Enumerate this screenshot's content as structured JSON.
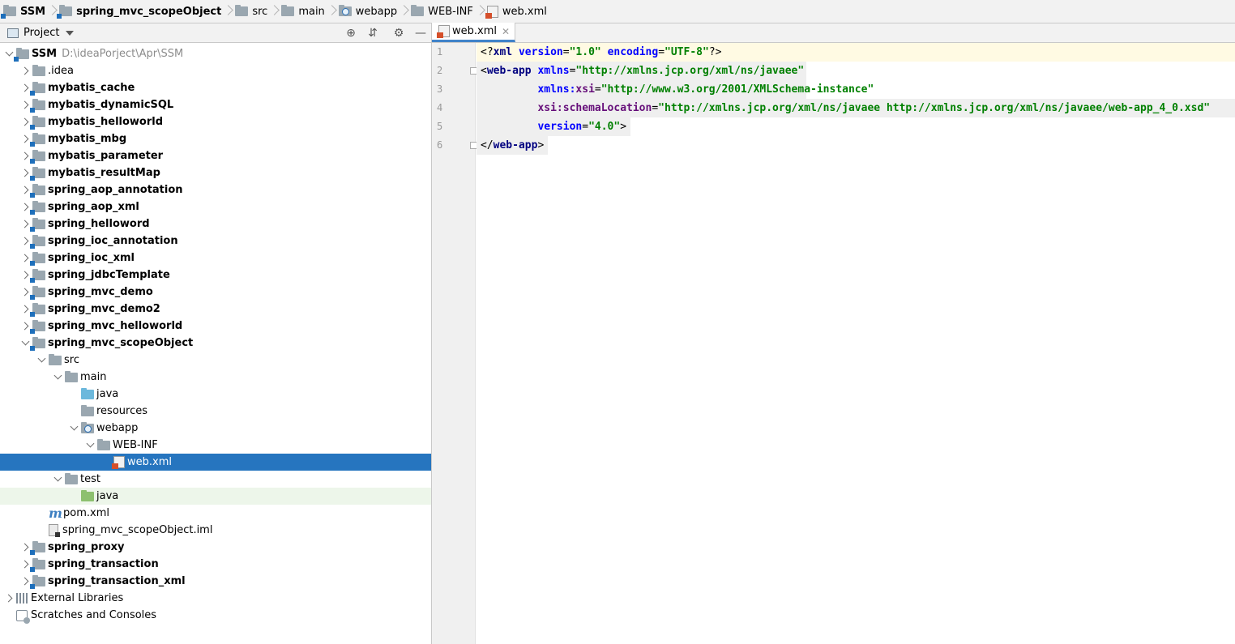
{
  "breadcrumbs": [
    {
      "label": "SSM",
      "icon": "module-folder-icon",
      "bold": true
    },
    {
      "label": "spring_mvc_scopeObject",
      "icon": "module-folder-icon",
      "bold": true
    },
    {
      "label": "src",
      "icon": "folder-icon",
      "bold": false
    },
    {
      "label": "main",
      "icon": "folder-icon",
      "bold": false
    },
    {
      "label": "webapp",
      "icon": "web-folder-icon",
      "bold": false
    },
    {
      "label": "WEB-INF",
      "icon": "folder-icon",
      "bold": false
    },
    {
      "label": "web.xml",
      "icon": "xml-file-icon",
      "bold": false
    }
  ],
  "project_panel": {
    "title": "Project",
    "header_buttons": [
      "locate-icon",
      "collapse-all-icon",
      "gear-icon",
      "hide-icon"
    ]
  },
  "tree": [
    {
      "label": "SSM",
      "path": "D:\\ideaPorject\\Apr\\SSM",
      "depth": 0,
      "arrow": "down",
      "icon": "module",
      "bold": true
    },
    {
      "label": ".idea",
      "depth": 1,
      "arrow": "right",
      "icon": "folder",
      "bold": false
    },
    {
      "label": "mybatis_cache",
      "depth": 1,
      "arrow": "right",
      "icon": "module",
      "bold": true
    },
    {
      "label": "mybatis_dynamicSQL",
      "depth": 1,
      "arrow": "right",
      "icon": "module",
      "bold": true
    },
    {
      "label": "mybatis_helloworld",
      "depth": 1,
      "arrow": "right",
      "icon": "module",
      "bold": true
    },
    {
      "label": "mybatis_mbg",
      "depth": 1,
      "arrow": "right",
      "icon": "module",
      "bold": true
    },
    {
      "label": "mybatis_parameter",
      "depth": 1,
      "arrow": "right",
      "icon": "module",
      "bold": true
    },
    {
      "label": "mybatis_resultMap",
      "depth": 1,
      "arrow": "right",
      "icon": "module",
      "bold": true
    },
    {
      "label": "spring_aop_annotation",
      "depth": 1,
      "arrow": "right",
      "icon": "module",
      "bold": true
    },
    {
      "label": "spring_aop_xml",
      "depth": 1,
      "arrow": "right",
      "icon": "module",
      "bold": true
    },
    {
      "label": "spring_helloword",
      "depth": 1,
      "arrow": "right",
      "icon": "module",
      "bold": true
    },
    {
      "label": "spring_ioc_annotation",
      "depth": 1,
      "arrow": "right",
      "icon": "module",
      "bold": true
    },
    {
      "label": "spring_ioc_xml",
      "depth": 1,
      "arrow": "right",
      "icon": "module",
      "bold": true
    },
    {
      "label": "spring_jdbcTemplate",
      "depth": 1,
      "arrow": "right",
      "icon": "module",
      "bold": true
    },
    {
      "label": "spring_mvc_demo",
      "depth": 1,
      "arrow": "right",
      "icon": "module",
      "bold": true
    },
    {
      "label": "spring_mvc_demo2",
      "depth": 1,
      "arrow": "right",
      "icon": "module",
      "bold": true
    },
    {
      "label": "spring_mvc_helloworld",
      "depth": 1,
      "arrow": "right",
      "icon": "module",
      "bold": true
    },
    {
      "label": "spring_mvc_scopeObject",
      "depth": 1,
      "arrow": "down",
      "icon": "module",
      "bold": true
    },
    {
      "label": "src",
      "depth": 2,
      "arrow": "down",
      "icon": "folder",
      "bold": false
    },
    {
      "label": "main",
      "depth": 3,
      "arrow": "down",
      "icon": "folder",
      "bold": false
    },
    {
      "label": "java",
      "depth": 4,
      "arrow": "none",
      "icon": "blue",
      "bold": false
    },
    {
      "label": "resources",
      "depth": 4,
      "arrow": "none",
      "icon": "folder",
      "bold": false
    },
    {
      "label": "webapp",
      "depth": 4,
      "arrow": "down",
      "icon": "web",
      "bold": false
    },
    {
      "label": "WEB-INF",
      "depth": 5,
      "arrow": "down",
      "icon": "folder",
      "bold": false
    },
    {
      "label": "web.xml",
      "depth": 6,
      "arrow": "none",
      "icon": "xml",
      "bold": false,
      "selected": true
    },
    {
      "label": "test",
      "depth": 3,
      "arrow": "down",
      "icon": "folder",
      "bold": false
    },
    {
      "label": "java",
      "depth": 4,
      "arrow": "none",
      "icon": "green",
      "bold": false,
      "hover": true
    },
    {
      "label": "pom.xml",
      "depth": 2,
      "arrow": "none",
      "icon": "maven",
      "bold": false
    },
    {
      "label": "spring_mvc_scopeObject.iml",
      "depth": 2,
      "arrow": "none",
      "icon": "iml",
      "bold": false
    },
    {
      "label": "spring_proxy",
      "depth": 1,
      "arrow": "right",
      "icon": "module",
      "bold": true
    },
    {
      "label": "spring_transaction",
      "depth": 1,
      "arrow": "right",
      "icon": "module",
      "bold": true
    },
    {
      "label": "spring_transaction_xml",
      "depth": 1,
      "arrow": "right",
      "icon": "module",
      "bold": true
    },
    {
      "label": "External Libraries",
      "depth": 0,
      "arrow": "right",
      "icon": "lib",
      "bold": false
    },
    {
      "label": "Scratches and Consoles",
      "depth": 0,
      "arrow": "none",
      "icon": "scratch",
      "bold": false
    }
  ],
  "editor": {
    "tab_label": "web.xml",
    "line_numbers": [
      "1",
      "2",
      "3",
      "4",
      "5",
      "6"
    ],
    "lines": [
      [
        {
          "t": "<?",
          "c": "pi"
        },
        {
          "t": "xml ",
          "c": "tagname"
        },
        {
          "t": "version",
          "c": "attr"
        },
        {
          "t": "=",
          "c": "punct"
        },
        {
          "t": "\"1.0\"",
          "c": "val"
        },
        {
          "t": " ",
          "c": "punct"
        },
        {
          "t": "encoding",
          "c": "attr"
        },
        {
          "t": "=",
          "c": "punct"
        },
        {
          "t": "\"UTF-8\"",
          "c": "val"
        },
        {
          "t": "?>",
          "c": "pi"
        }
      ],
      [
        {
          "t": "<",
          "c": "punct"
        },
        {
          "t": "web-app ",
          "c": "tagname"
        },
        {
          "t": "xmlns",
          "c": "attr"
        },
        {
          "t": "=",
          "c": "punct"
        },
        {
          "t": "\"http://xmlns.jcp.org/xml/ns/javaee\"",
          "c": "val"
        }
      ],
      [
        {
          "t": "         ",
          "c": "punct"
        },
        {
          "t": "xmlns:",
          "c": "attr"
        },
        {
          "t": "xsi",
          "c": "ns"
        },
        {
          "t": "=",
          "c": "punct"
        },
        {
          "t": "\"http://www.w3.org/2001/XMLSchema-instance\"",
          "c": "val"
        }
      ],
      [
        {
          "t": "         ",
          "c": "punct"
        },
        {
          "t": "xsi:",
          "c": "ns"
        },
        {
          "t": "schemaLocation",
          "c": "ns"
        },
        {
          "t": "=",
          "c": "punct"
        },
        {
          "t": "\"http://xmlns.jcp.org/xml/ns/javaee http://xmlns.jcp.org/xml/ns/javaee/web-app_4_0.xsd\"",
          "c": "val"
        }
      ],
      [
        {
          "t": "         ",
          "c": "punct"
        },
        {
          "t": "version",
          "c": "attr"
        },
        {
          "t": "=",
          "c": "punct"
        },
        {
          "t": "\"4.0\"",
          "c": "val"
        },
        {
          "t": ">",
          "c": "punct"
        }
      ],
      [
        {
          "t": "</",
          "c": "punct"
        },
        {
          "t": "web-app",
          "c": "tagname"
        },
        {
          "t": ">",
          "c": "punct"
        }
      ]
    ]
  }
}
